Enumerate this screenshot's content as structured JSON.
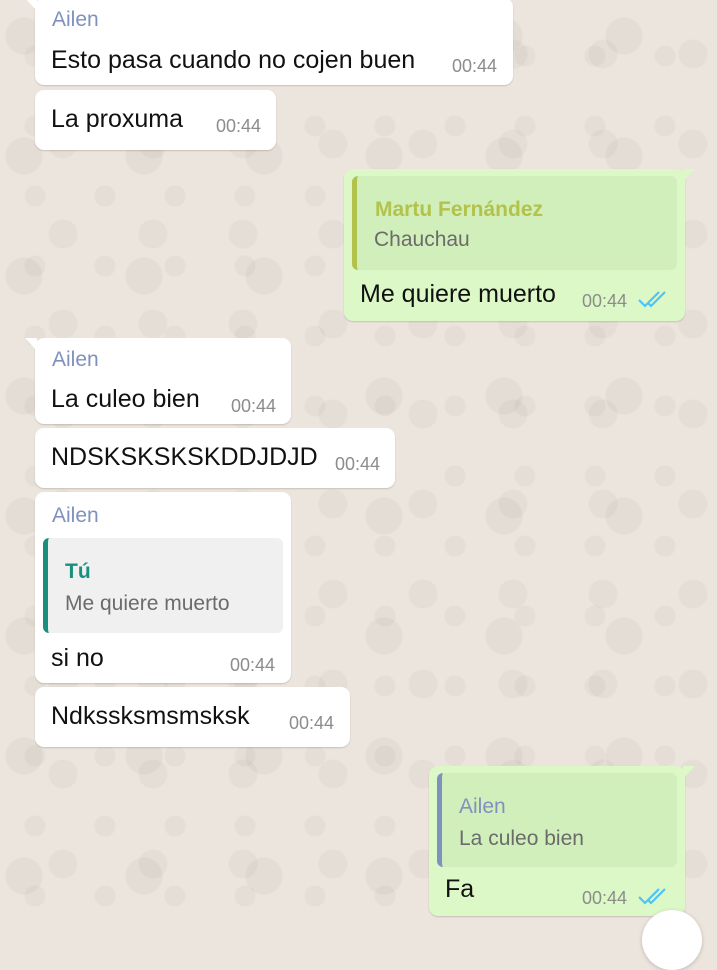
{
  "colors": {
    "incoming_bubble": "#ffffff",
    "outgoing_bubble": "#dcf8c6",
    "sender_name": "#7f91be",
    "read_ticks": "#4fc3f7",
    "quote_author_martu": "#b2c24a",
    "quote_author_tu": "#1b8f7d",
    "quote_author_ailen": "#7f91be"
  },
  "messages": [
    {
      "direction": "in",
      "sender": "Ailen",
      "text": "Esto pasa cuando no cojen buen",
      "time": "00:44"
    },
    {
      "direction": "in",
      "text": "La proxuma",
      "time": "00:44"
    },
    {
      "direction": "out",
      "quote": {
        "author": "Martu Fernández",
        "text": "Chauchau"
      },
      "text": "Me quiere muerto",
      "time": "00:44",
      "status": "read-double-check-icon"
    },
    {
      "direction": "in",
      "sender": "Ailen",
      "text": "La culeo bien",
      "time": "00:44"
    },
    {
      "direction": "in",
      "text": "NDSKSKSKSKDDJDJD",
      "time": "00:44"
    },
    {
      "direction": "in",
      "sender": "Ailen",
      "quote": {
        "author": "Tú",
        "text": "Me quiere muerto"
      },
      "text": "si no",
      "time": "00:44"
    },
    {
      "direction": "in",
      "text": "Ndkssksmsmsksk",
      "time": "00:44"
    },
    {
      "direction": "out",
      "quote": {
        "author": "Ailen",
        "text": "La culeo bien"
      },
      "text": "Fa",
      "time": "00:44",
      "status": "read-double-check-icon"
    }
  ]
}
